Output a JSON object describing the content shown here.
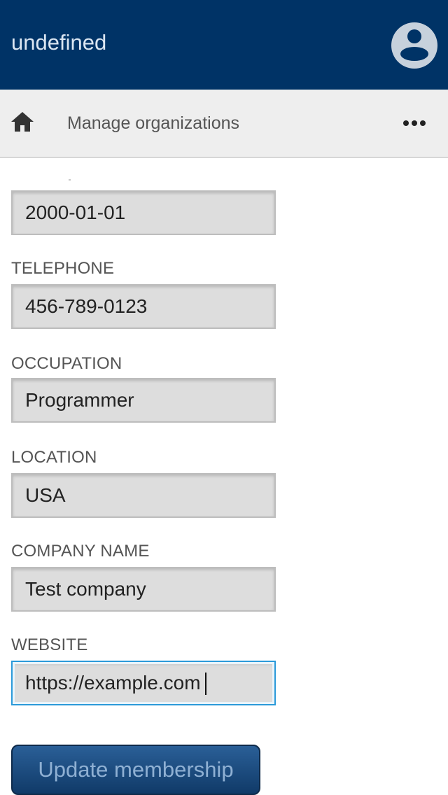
{
  "header": {
    "title": "undefined",
    "avatar_icon": "user-circle-icon",
    "background": "#003366"
  },
  "subnav": {
    "home_icon": "home-icon",
    "title": "Manage organizations",
    "more_icon": "more-horizontal-icon"
  },
  "form": {
    "date": {
      "value": "2000-01-01"
    },
    "telephone": {
      "label": "TELEPHONE",
      "value": "456-789-0123"
    },
    "occupation": {
      "label": "OCCUPATION",
      "value": "Programmer"
    },
    "location": {
      "label": "LOCATION",
      "value": "USA"
    },
    "company_name": {
      "label": "COMPANY NAME",
      "value": "Test company"
    },
    "website": {
      "label": "WEBSITE",
      "value": "https://example.com",
      "focused": true
    },
    "submit_label": "Update membership"
  },
  "colors": {
    "focus_border": "#2b9ad9",
    "button": "#1a4a80",
    "button_text": "#8fb0d3"
  }
}
